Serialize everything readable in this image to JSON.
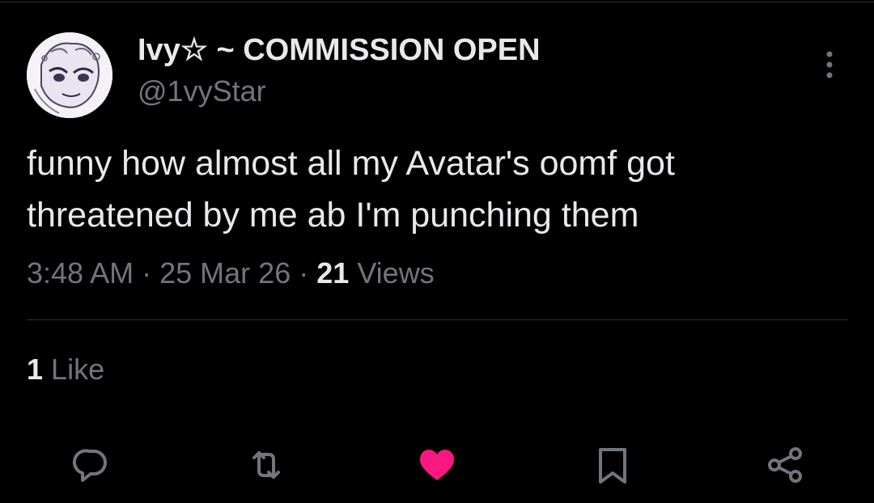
{
  "tweet": {
    "author": {
      "display_name": "Ivy☆ ~ COMMISSION OPEN",
      "handle": "@1vyStar"
    },
    "text": "funny how almost all my Avatar's oomf got\nthreatened by me ab I'm punching them",
    "time": "3:48 AM",
    "date": "25 Mar 26",
    "separator": "·",
    "views_count": "21",
    "views_label": "Views",
    "like_count": "1",
    "like_label": "Like",
    "liked": true
  },
  "icons": {
    "more": "more-vertical-icon",
    "reply": "reply-icon",
    "retweet": "retweet-icon",
    "like": "heart-icon",
    "bookmark": "bookmark-icon",
    "share": "share-icon"
  },
  "colors": {
    "background": "#000000",
    "primary_text": "#e7e9ea",
    "secondary_text": "#71767b",
    "divider": "#2f3336",
    "like_active": "#f91880"
  }
}
